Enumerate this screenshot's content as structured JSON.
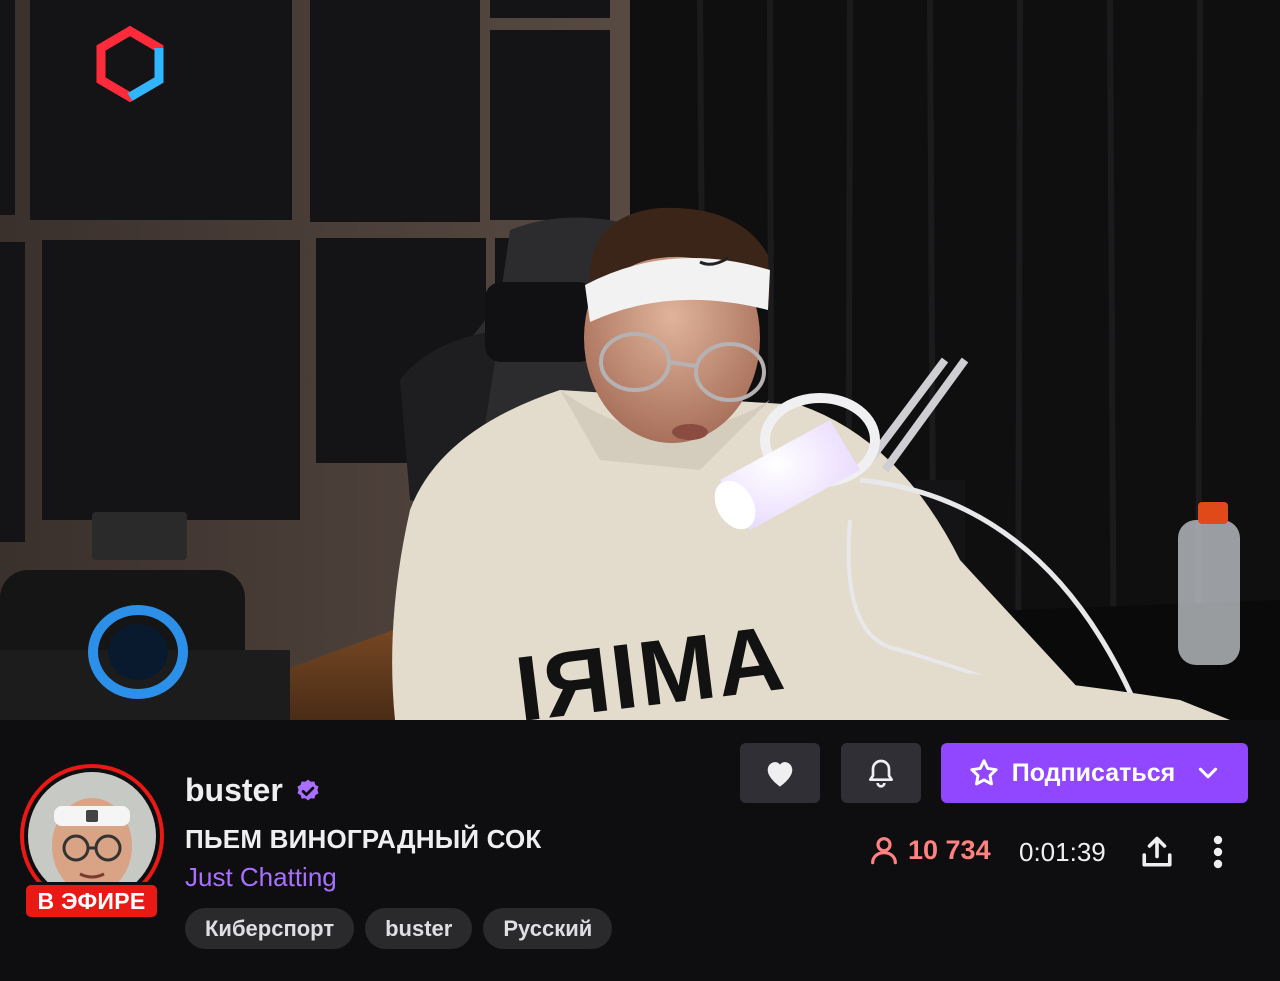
{
  "video": {
    "sweater_text": "IЯIMA"
  },
  "channel": {
    "name": "buster",
    "live_label": "В ЭФИРЕ",
    "stream_title": "ПЬЕМ ВИНОГРАДНЫЙ СОК",
    "category": "Just Chatting",
    "tags": [
      "Киберспорт",
      "buster",
      "Русский"
    ]
  },
  "actions": {
    "subscribe_label": "Подписаться",
    "viewer_count": "10 734",
    "uptime": "0:01:39"
  },
  "colors": {
    "live": "#e91916",
    "accent": "#9147ff",
    "category": "#a970ff",
    "viewers": "#ff8280",
    "background": "#0e0e10"
  },
  "icons": {
    "follow": "heart-icon",
    "notify": "bell-icon",
    "subscribe": "star-icon",
    "dropdown": "chevron-down-icon",
    "viewers": "person-icon",
    "share": "share-icon",
    "more": "more-vertical-icon",
    "verified": "verified-badge-icon",
    "overlay_logo": "hexagon-logo-icon"
  }
}
